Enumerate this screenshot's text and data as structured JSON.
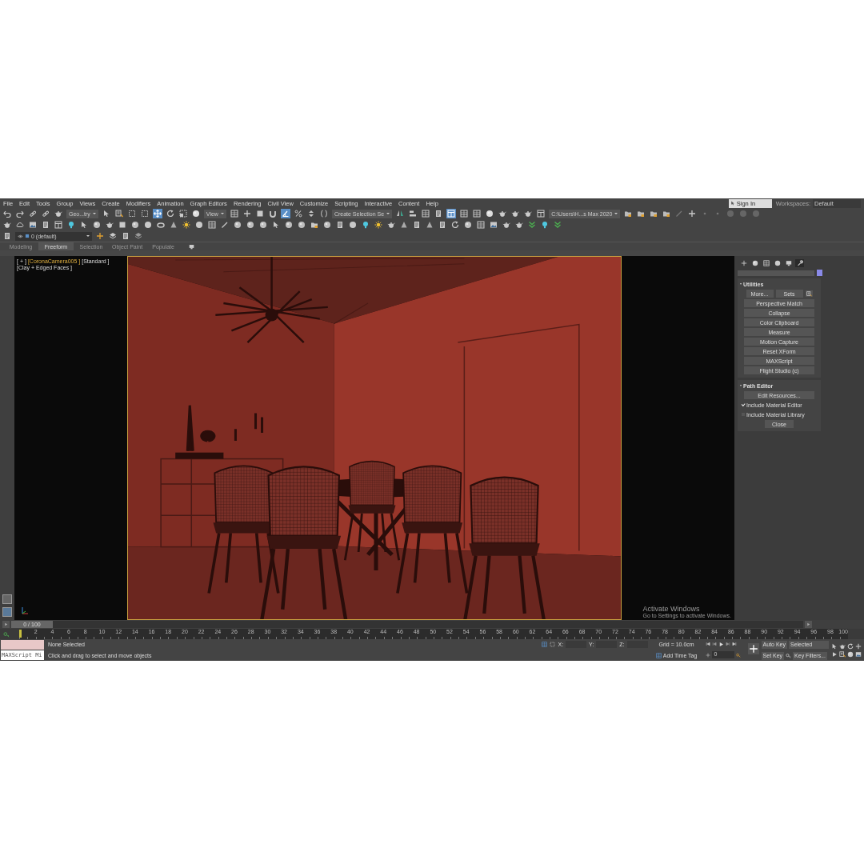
{
  "menu_bar": {
    "items": [
      "File",
      "Edit",
      "Tools",
      "Group",
      "Views",
      "Create",
      "Modifiers",
      "Animation",
      "Graph Editors",
      "Rendering",
      "Civil View",
      "Customize",
      "Scripting",
      "Interactive",
      "Content",
      "Help"
    ],
    "sign_in": "Sign In",
    "workspaces_label": "Workspaces:",
    "workspace": "Default"
  },
  "main_toolbar": {
    "items": [
      {
        "kind": "button",
        "selected": false
      },
      {
        "kind": "button",
        "selected": false
      },
      {
        "kind": "button",
        "selected": false
      },
      {
        "kind": "button",
        "selected": false
      },
      {
        "kind": "button",
        "selected": false
      },
      {
        "kind": "dropdown",
        "value": "Geo...try"
      },
      {
        "kind": "button",
        "selected": false
      },
      {
        "kind": "button",
        "selected": false
      },
      {
        "kind": "button",
        "selected": false
      },
      {
        "kind": "button",
        "selected": false
      },
      {
        "kind": "button",
        "selected": true
      },
      {
        "kind": "button",
        "selected": false
      },
      {
        "kind": "button",
        "selected": false
      },
      {
        "kind": "button",
        "selected": false
      },
      {
        "kind": "dropdown",
        "value": "View"
      },
      {
        "kind": "button",
        "selected": false
      },
      {
        "kind": "button",
        "selected": false
      },
      {
        "kind": "button",
        "selected": false
      },
      {
        "kind": "button",
        "selected": false
      },
      {
        "kind": "button",
        "selected": true
      },
      {
        "kind": "button",
        "selected": false
      },
      {
        "kind": "button",
        "selected": false
      },
      {
        "kind": "button",
        "selected": false
      },
      {
        "kind": "dropdown",
        "value": "Create Selection Se"
      },
      {
        "kind": "button",
        "selected": false
      },
      {
        "kind": "button",
        "selected": false
      },
      {
        "kind": "button",
        "selected": false
      },
      {
        "kind": "button",
        "selected": false
      },
      {
        "kind": "button",
        "selected": true
      },
      {
        "kind": "button",
        "selected": false
      },
      {
        "kind": "button",
        "selected": false
      },
      {
        "kind": "button",
        "selected": false
      },
      {
        "kind": "button",
        "selected": false
      },
      {
        "kind": "button",
        "selected": false
      },
      {
        "kind": "button",
        "selected": false
      },
      {
        "kind": "button",
        "selected": false
      },
      {
        "kind": "dropdown",
        "value": "C:\\Users\\H...s Max 2020"
      },
      {
        "kind": "button",
        "selected": false
      },
      {
        "kind": "button",
        "selected": false
      },
      {
        "kind": "button",
        "selected": false
      },
      {
        "kind": "button",
        "selected": false
      },
      {
        "kind": "button",
        "selected": false
      },
      {
        "kind": "button",
        "selected": false
      },
      {
        "kind": "button",
        "selected": false
      },
      {
        "kind": "button",
        "selected": false
      },
      {
        "kind": "button",
        "selected": false
      },
      {
        "kind": "button",
        "selected": false
      },
      {
        "kind": "button",
        "selected": false
      }
    ]
  },
  "layer_toolbar": {
    "layer": "0 (default)"
  },
  "ribbon_tabs": [
    {
      "label": "Modeling",
      "selected": false
    },
    {
      "label": "Freeform",
      "selected": true
    },
    {
      "label": "Selection",
      "selected": false
    },
    {
      "label": "Object Paint",
      "selected": false
    },
    {
      "label": "Populate",
      "selected": false
    }
  ],
  "viewport": {
    "label_parts": [
      "[ + ]",
      "[CoronaCamera005 ]",
      "[Standard ]",
      "[Clay + Edged Faces ]"
    ]
  },
  "command_panel": {
    "tabs": [
      {
        "selected": false
      },
      {
        "selected": false
      },
      {
        "selected": false
      },
      {
        "selected": false
      },
      {
        "selected": false
      },
      {
        "selected": true
      }
    ],
    "rollouts": [
      {
        "title": "Utilities",
        "expanded": true,
        "top_buttons": [
          "More...",
          "Sets"
        ],
        "buttons": [
          "Perspective Match",
          "Collapse",
          "Color Clipboard",
          "Measure",
          "Motion Capture",
          "Reset XForm",
          "MAXScript",
          "Flight Studio (c)"
        ]
      },
      {
        "title": "Path Editor",
        "expanded": true,
        "buttons": [
          "Edit Resources..."
        ],
        "checkboxes": [
          {
            "label": "Include Material Editor",
            "checked": true
          },
          {
            "label": "Include Material Library",
            "checked": false
          }
        ],
        "close": "Close"
      }
    ]
  },
  "time_slider": {
    "label": "0 / 100",
    "level": 0
  },
  "track_bar": {
    "ticks": [
      "2",
      "4",
      "6",
      "8",
      "10",
      "12",
      "14",
      "16",
      "18",
      "20",
      "22",
      "24",
      "26",
      "28",
      "30",
      "32",
      "34",
      "36",
      "38",
      "40",
      "42",
      "44",
      "46",
      "48",
      "50",
      "52",
      "54",
      "56",
      "58",
      "60",
      "62",
      "64",
      "66",
      "68",
      "70",
      "72",
      "74",
      "76",
      "78",
      "80",
      "82",
      "84",
      "86",
      "88",
      "90",
      "92",
      "94",
      "96",
      "98",
      "100"
    ]
  },
  "status_bar": {
    "listener": "MAXScript Mi",
    "selection": "None Selected",
    "prompt": "Click and drag to select and move objects",
    "coords": [
      {
        "axis": "X:"
      },
      {
        "axis": "Y:"
      },
      {
        "axis": "Z:"
      }
    ],
    "grid": "Grid = 10.0cm",
    "add_time_tag": "Add Time Tag",
    "auto_key": "Auto Key",
    "set_key": "Set Key",
    "key_mode": "Selected",
    "key_filters": "Key Filters...",
    "frame": "0"
  },
  "os_notice": {
    "title": "Activate Windows",
    "text": "Go to Settings to activate Windows."
  }
}
